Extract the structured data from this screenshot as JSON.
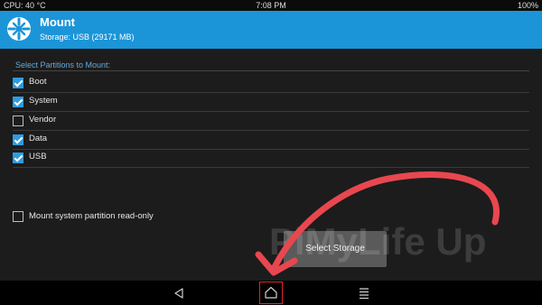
{
  "status": {
    "cpu": "CPU: 40 °C",
    "time": "7:08 PM",
    "battery": "100%"
  },
  "header": {
    "title": "Mount",
    "subtitle": "Storage: USB (29171 MB)",
    "logo_icon": "twrp-logo-icon"
  },
  "section_label": "Select Partitions to Mount:",
  "partitions": [
    {
      "label": "Boot",
      "checked": true
    },
    {
      "label": "System",
      "checked": true
    },
    {
      "label": "Vendor",
      "checked": false
    },
    {
      "label": "Data",
      "checked": true
    },
    {
      "label": "USB",
      "checked": true
    }
  ],
  "readonly_option": {
    "label": "Mount system partition read-only",
    "checked": false
  },
  "select_storage_label": "Select Storage",
  "watermark": "PiMyLife Up",
  "nav": {
    "back_icon": "back-icon",
    "home_icon": "home-icon",
    "menu_icon": "menu-icon"
  },
  "colors": {
    "header_bg": "#1b95d8",
    "check_accent": "#2f9be0",
    "arrow": "#e8474f",
    "highlight": "#e0242c"
  }
}
